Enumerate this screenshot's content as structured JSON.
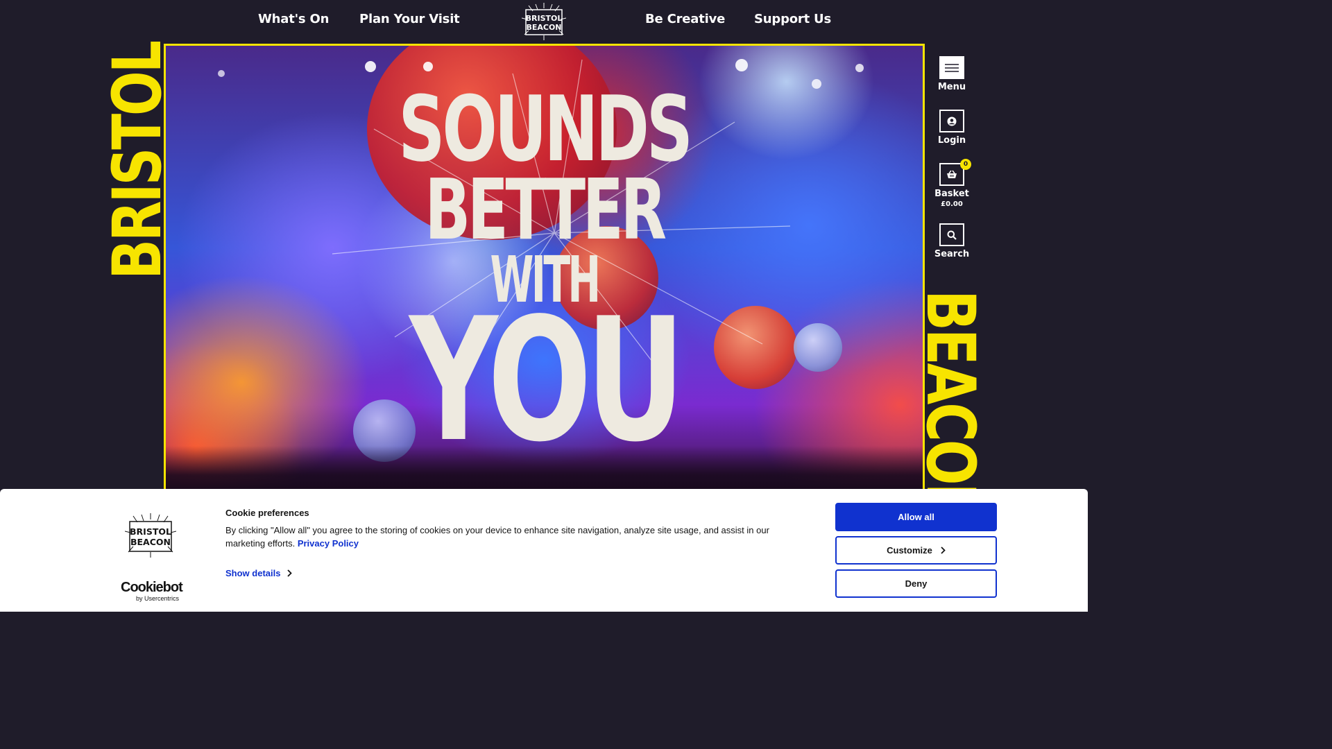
{
  "nav": {
    "whats_on": "What's On",
    "plan_visit": "Plan Your Visit",
    "be_creative": "Be Creative",
    "support_us": "Support Us",
    "logo_line1": "BRISTOL",
    "logo_line2": "BEACON"
  },
  "hero": {
    "line1": "SOUNDS",
    "line2": "BETTER",
    "line3": "WITH",
    "line4": "YOU",
    "side_left": "BRISTOL",
    "side_right": "BEACON"
  },
  "utilities": {
    "menu": "Menu",
    "login": "Login",
    "basket": "Basket",
    "basket_total": "£0.00",
    "basket_count": "0",
    "search": "Search"
  },
  "cookie": {
    "logo_line1": "BRISTOL",
    "logo_line2": "BEACON",
    "title": "Cookie preferences",
    "body": "By clicking \"Allow all\" you agree to the storing of cookies on your device to enhance site navigation, analyze site usage, and assist in our marketing efforts.",
    "policy_link": "Privacy Policy",
    "show_details": "Show details",
    "allow_all": "Allow all",
    "customize": "Customize",
    "deny": "Deny",
    "brand": "Cookiebot",
    "brand_sub": "by Usercentrics"
  },
  "colors": {
    "background": "#1f1c2a",
    "accent_yellow": "#f7e400",
    "button_blue": "#1032cf"
  }
}
